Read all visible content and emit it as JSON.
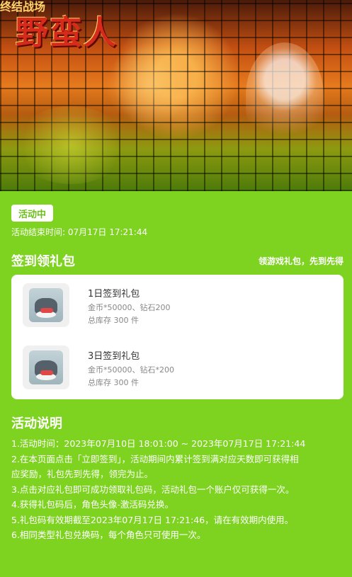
{
  "banner": {
    "subtitle": "终结战场",
    "title": "野蛮人"
  },
  "status_badge": "活动中",
  "end_time": "活动结束时间: 07月17日 17:21:44",
  "signin": {
    "title": "签到领礼包",
    "hint": "领游戏礼包，先到先得",
    "items": [
      {
        "name": "1日签到礼包",
        "desc": "金币*50000、钻石200",
        "stock": "总库存 300 件"
      },
      {
        "name": "3日签到礼包",
        "desc": "金币*50000、钻石*200",
        "stock": "总库存 300 件"
      }
    ]
  },
  "rules": {
    "title": "活动说明",
    "lines": [
      "1.活动时间：2023年07月10日 18:01:00 ~ 2023年07月17日 17:21:44",
      "2.在本页面点击「立即签到」，活动期间内累计签到满对应天数即可获得相",
      "应奖励，礼包先到先得，领完为止。",
      "3.点击对应礼包即可成功领取礼包码，活动礼包一个账户仅可获得一次。",
      "4.获得礼包码后，角色头像-激活码兑换。",
      "5.礼包码有效期截至2023年07月17日 17:21:46，请在有效期内使用。",
      "6.相同类型礼包兑换码，每个角色只可使用一次。"
    ]
  }
}
